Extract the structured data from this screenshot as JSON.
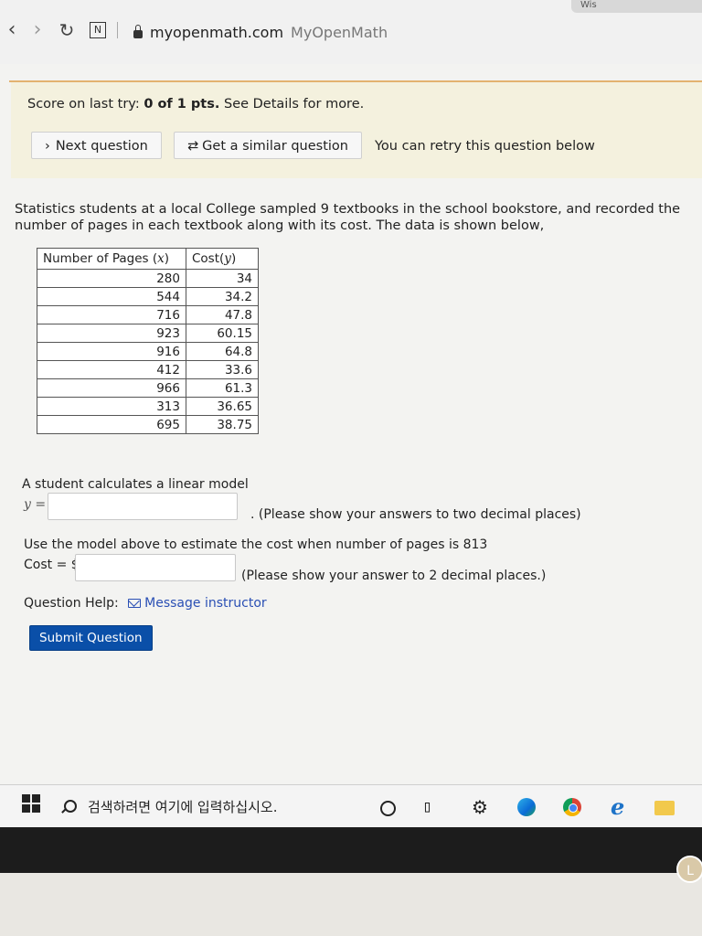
{
  "browser": {
    "tab_remnant": "Wis",
    "n_icon": "N",
    "domain": "myopenmath.com",
    "site_title": "MyOpenMath"
  },
  "score": {
    "prefix": "Score on last try:",
    "value": "0 of 1 pts.",
    "suffix": "See Details for more.",
    "next_button": "Next question",
    "similar_button": "Get a similar question",
    "retry_text": "You can retry this question below"
  },
  "question": {
    "intro": "Statistics students at a local College sampled 9 textbooks in the school bookstore, and recorded the number of pages in each textbook along with its cost. The data is shown below,",
    "table": {
      "col1": "Number of Pages",
      "col1_var": "x",
      "col2": "Cost",
      "col2_var": "y",
      "rows": [
        [
          "280",
          "34"
        ],
        [
          "544",
          "34.2"
        ],
        [
          "716",
          "47.8"
        ],
        [
          "923",
          "60.15"
        ],
        [
          "916",
          "64.8"
        ],
        [
          "412",
          "33.6"
        ],
        [
          "966",
          "61.3"
        ],
        [
          "313",
          "36.65"
        ],
        [
          "695",
          "38.75"
        ]
      ]
    },
    "model_label": "A student calculates a linear model",
    "y_label": "y =",
    "y_value": "",
    "y_hint": ". (Please show your answers to two decimal places)",
    "estimate_label": "Use the model above to estimate the cost when number of pages is 813",
    "cost_label": "Cost = $",
    "cost_value": "",
    "cost_hint": "(Please show your answer to 2 decimal places.)",
    "help_label": "Question Help:",
    "help_link": "Message instructor",
    "submit": "Submit Question"
  },
  "taskbar": {
    "search_text": "검색하려면 여기에 입력하십시오."
  },
  "bezel": {
    "logo": "L"
  }
}
